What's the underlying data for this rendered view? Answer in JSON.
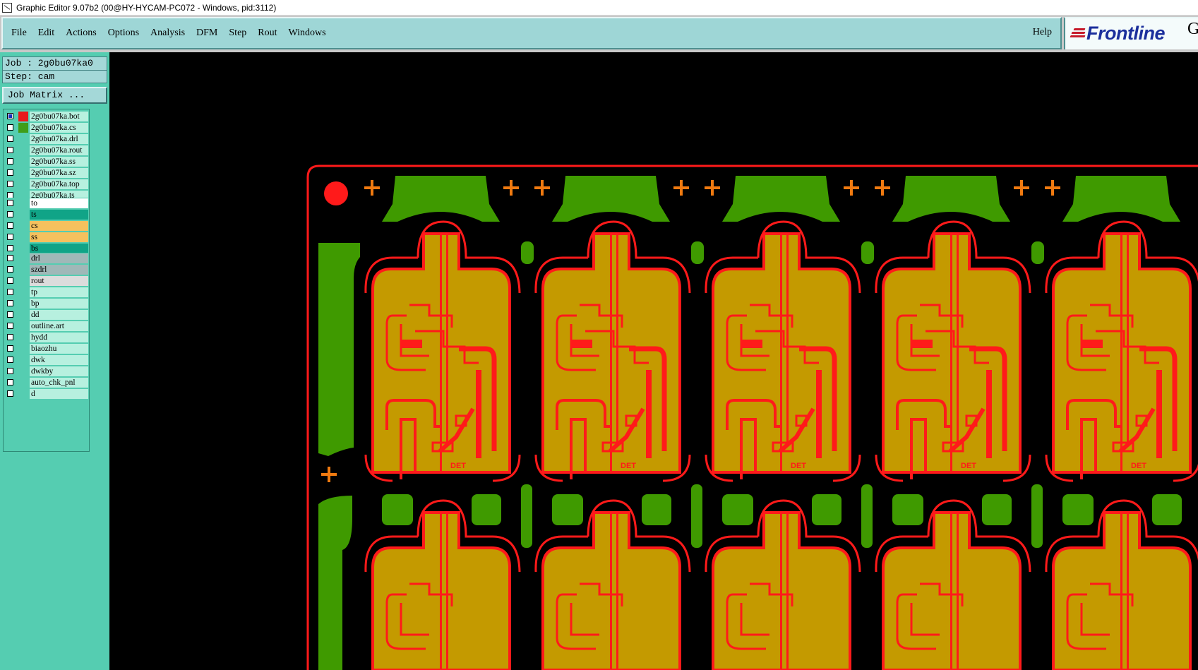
{
  "window": {
    "title": "Graphic Editor 9.07b2 (00@HY-HYCAM-PC072 - Windows, pid:3112)"
  },
  "menu": {
    "items": [
      "File",
      "Edit",
      "Actions",
      "Options",
      "Analysis",
      "DFM",
      "Step",
      "Rout",
      "Windows"
    ],
    "help": "Help"
  },
  "logo": {
    "brand": "Frontline",
    "extra": "G"
  },
  "job": {
    "job_line": "Job : 2g0bu07ka0",
    "step_line": "Step: cam",
    "matrix_button": "Job Matrix ..."
  },
  "layers": {
    "groups": [
      [
        {
          "name": "2g0bu07ka.bot",
          "color": "#b7f0df",
          "swatch": "#e8191c",
          "checked": true
        },
        {
          "name": "2g0bu07ka.cs",
          "color": "#b7f0df",
          "swatch": "#3f9e1a",
          "checked": false
        },
        {
          "name": "2g0bu07ka.drl",
          "color": "#b7f0df",
          "swatch": "",
          "checked": false
        },
        {
          "name": "2g0bu07ka.rout",
          "color": "#b7f0df",
          "swatch": "",
          "checked": false
        },
        {
          "name": "2g0bu07ka.ss",
          "color": "#b7f0df",
          "swatch": "",
          "checked": false
        },
        {
          "name": "2g0bu07ka.sz",
          "color": "#b7f0df",
          "swatch": "",
          "checked": false
        },
        {
          "name": "2g0bu07ka.top",
          "color": "#b7f0df",
          "swatch": "",
          "checked": false
        },
        {
          "name": "2g0bu07ka.ts",
          "color": "#b7f0df",
          "swatch": "",
          "checked": false
        }
      ],
      [
        {
          "name": "to",
          "color": "#ffffff",
          "swatch": "",
          "checked": false
        },
        {
          "name": "ts",
          "color": "#10a487",
          "swatch": "",
          "checked": false
        },
        {
          "name": "cs",
          "color": "#f5c15e",
          "swatch": "",
          "checked": false
        },
        {
          "name": "ss",
          "color": "#f5c15e",
          "swatch": "",
          "checked": false
        },
        {
          "name": "bs",
          "color": "#10a487",
          "swatch": "",
          "checked": false
        }
      ],
      [
        {
          "name": "drl",
          "color": "#a0b8b8",
          "swatch": "",
          "checked": false
        },
        {
          "name": "szdrl",
          "color": "#a0b8b8",
          "swatch": "",
          "checked": false
        },
        {
          "name": "rout",
          "color": "#dcdcdc",
          "swatch": "",
          "checked": false
        }
      ],
      [
        {
          "name": "tp",
          "color": "#b7f0df",
          "swatch": "",
          "checked": false
        },
        {
          "name": "bp",
          "color": "#b7f0df",
          "swatch": "",
          "checked": false
        },
        {
          "name": "dd",
          "color": "#b7f0df",
          "swatch": "",
          "checked": false
        },
        {
          "name": "outline.art",
          "color": "#b7f0df",
          "swatch": "",
          "checked": false
        },
        {
          "name": "hydd",
          "color": "#b7f0df",
          "swatch": "",
          "checked": false
        },
        {
          "name": "biaozhu",
          "color": "#b7f0df",
          "swatch": "",
          "checked": false
        },
        {
          "name": "dwk",
          "color": "#b7f0df",
          "swatch": "",
          "checked": false
        },
        {
          "name": "dwkby",
          "color": "#b7f0df",
          "swatch": "",
          "checked": false
        },
        {
          "name": "auto_chk_pnl",
          "color": "#b7f0df",
          "swatch": "",
          "checked": false
        },
        {
          "name": "d",
          "color": "#b7f0df",
          "swatch": "",
          "checked": false
        }
      ]
    ]
  },
  "board": {
    "unit_label": "DET",
    "colors": {
      "copper": "#c49a00",
      "trace": "#ff1a1a",
      "mask": "#3f9a00",
      "fiducial": "#f07a10",
      "background": "#000000"
    }
  }
}
